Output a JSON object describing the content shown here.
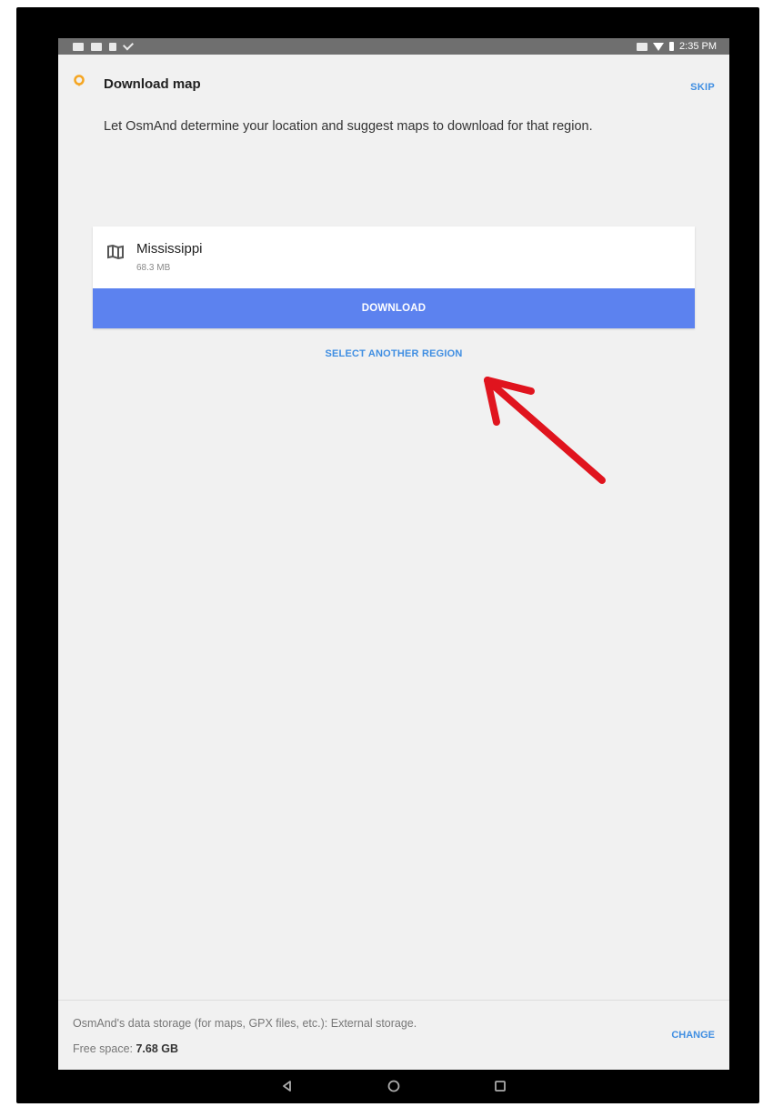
{
  "status_bar": {
    "time": "2:35 PM"
  },
  "header": {
    "title": "Download map",
    "skip_label": "SKIP",
    "accent_color": "#f5a623"
  },
  "description": "Let OsmAnd determine your location and suggest maps to download for that region.",
  "region_card": {
    "name": "Mississippi",
    "size": "68.3 MB",
    "download_label": "DOWNLOAD",
    "button_color": "#5c82ef"
  },
  "select_region_label": "SELECT ANOTHER REGION",
  "footer": {
    "storage_text": "OsmAnd's data storage (for maps, GPX files, etc.): External storage.",
    "free_space_label": "Free space: ",
    "free_space_value": "7.68 GB",
    "change_label": "CHANGE"
  },
  "nav_bar": {
    "icons": [
      "back-icon",
      "home-icon",
      "recents-icon"
    ]
  },
  "annotation": {
    "arrow_color": "#e0141e"
  }
}
